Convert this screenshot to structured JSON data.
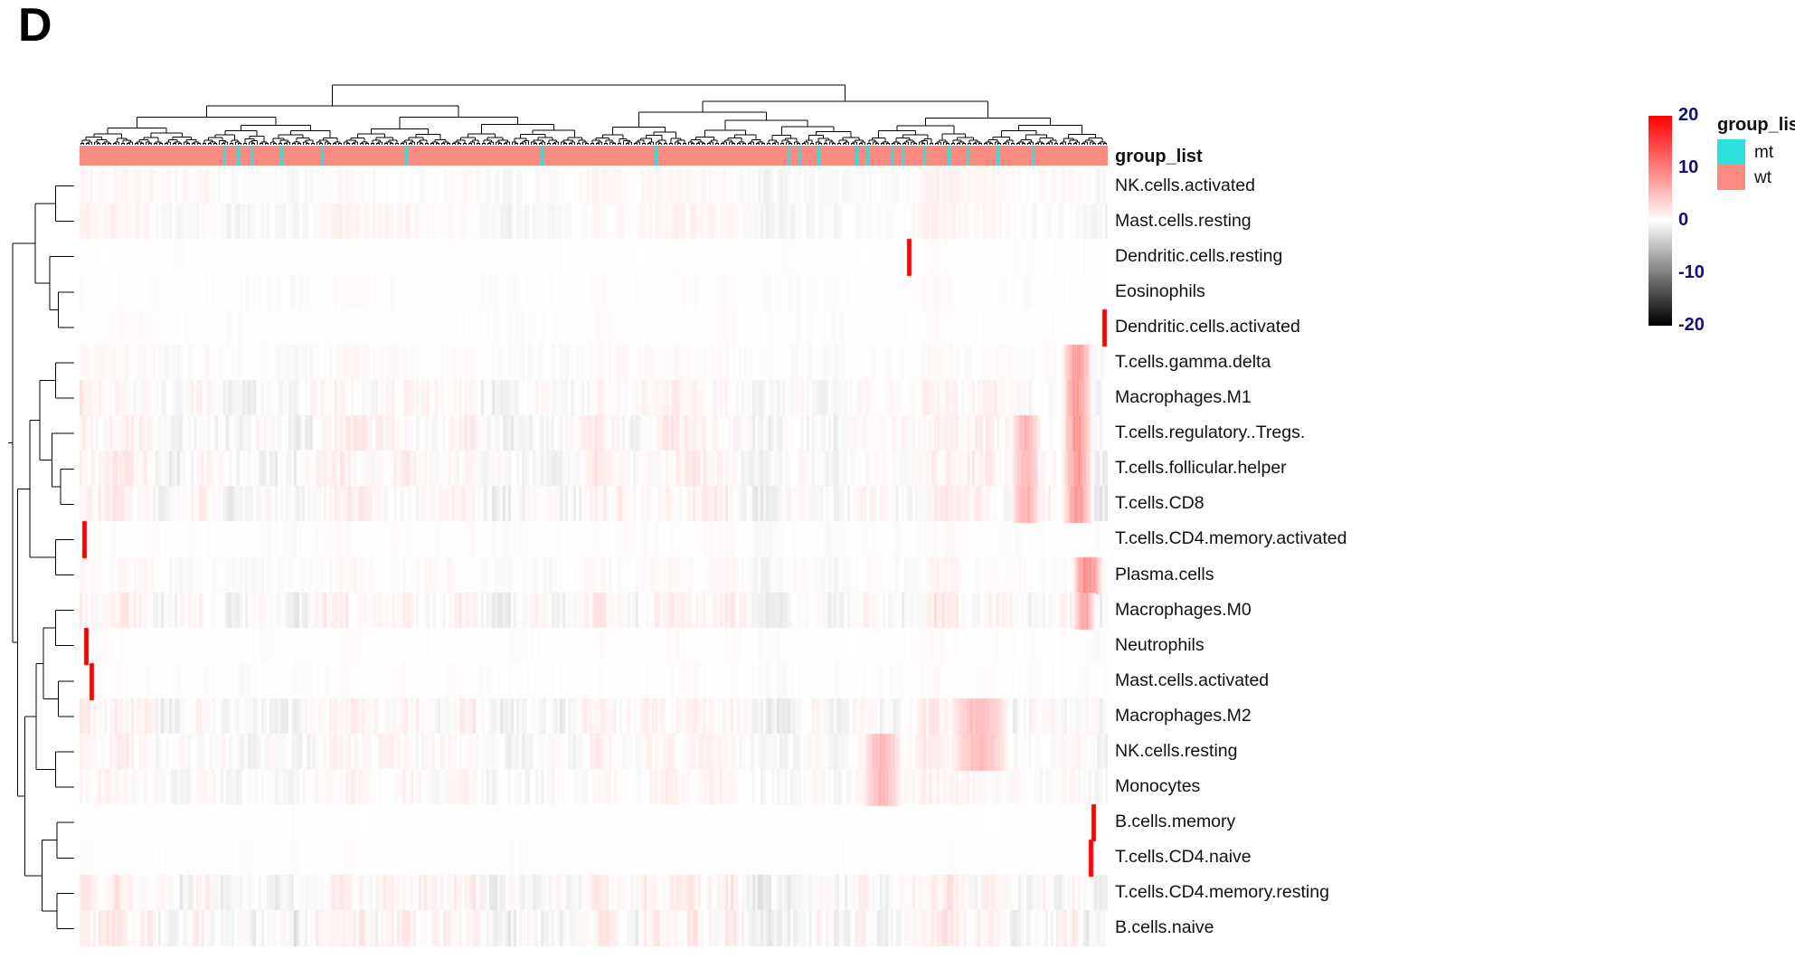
{
  "panel": {
    "letter": "D"
  },
  "annotation": {
    "title": "group_list",
    "track_name": "group_list"
  },
  "legend": {
    "title": "group_list",
    "items": [
      {
        "label": "mt",
        "color": "#2ee0dc"
      },
      {
        "label": "wt",
        "color": "#fb8a80"
      }
    ]
  },
  "colorbar": {
    "ticks": [
      "20",
      "10",
      "0",
      "-10",
      "-20"
    ],
    "tick_values": [
      20,
      10,
      0,
      -10,
      -20
    ],
    "min": -20,
    "max": 20,
    "high_color": "#ff0000",
    "mid_color": "#ffffff",
    "low_color": "#000000"
  },
  "chart_data": {
    "type": "heatmap",
    "title": "",
    "xlabel": "",
    "ylabel": "",
    "grid": false,
    "legend_position": "right",
    "zlim": [
      -20,
      20
    ],
    "colorscale": [
      "#000000",
      "#ffffff",
      "#ff0000"
    ],
    "n_columns": 379,
    "row_labels": [
      "NK.cells.activated",
      "Mast.cells.resting",
      "Dendritic.cells.resting",
      "Eosinophils",
      "Dendritic.cells.activated",
      "T.cells.gamma.delta",
      "Macrophages.M1",
      "T.cells.regulatory..Tregs.",
      "T.cells.follicular.helper",
      "T.cells.CD8",
      "T.cells.CD4.memory.activated",
      "Plasma.cells",
      "Macrophages.M0",
      "Neutrophils",
      "Mast.cells.activated",
      "Macrophages.M2",
      "NK.cells.resting",
      "Monocytes",
      "B.cells.memory",
      "T.cells.CD4.naive",
      "T.cells.CD4.memory.resting",
      "B.cells.naive"
    ],
    "column_annotation": {
      "name": "group_list",
      "categories": [
        "mt",
        "wt"
      ],
      "colors": {
        "mt": "#2ee0dc",
        "wt": "#fb8a80"
      },
      "mt_column_indices": [
        53,
        58,
        63,
        74,
        89,
        120,
        170,
        212,
        261,
        265,
        272,
        286,
        290,
        299,
        303,
        311,
        320,
        327,
        338,
        351
      ]
    },
    "row_activity": [
      0.3,
      0.34,
      0.07,
      0.12,
      0.1,
      0.22,
      0.52,
      0.6,
      0.58,
      0.62,
      0.14,
      0.26,
      0.55,
      0.1,
      0.12,
      0.62,
      0.46,
      0.4,
      0.05,
      0.07,
      0.66,
      0.7
    ],
    "row_hot_spots": [
      {
        "row": 2,
        "col_frac": 0.805,
        "intensity": 1.0
      },
      {
        "row": 4,
        "col_frac": 0.995,
        "intensity": 1.0
      },
      {
        "row": 10,
        "col_frac": 0.003,
        "intensity": 1.0
      },
      {
        "row": 13,
        "col_frac": 0.005,
        "intensity": 1.0
      },
      {
        "row": 14,
        "col_frac": 0.01,
        "intensity": 1.0
      },
      {
        "row": 18,
        "col_frac": 0.985,
        "intensity": 1.0
      },
      {
        "row": 19,
        "col_frac": 0.982,
        "intensity": 1.0
      }
    ]
  }
}
